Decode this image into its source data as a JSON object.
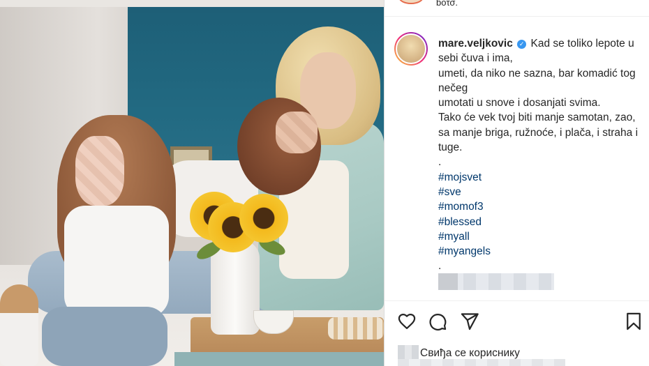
{
  "post": {
    "top_snippet": "boτσ.",
    "username": "mare.veljkovic",
    "verified_glyph": "✓",
    "caption_first": "Kad se toliko lepote u sebi čuva i ima,",
    "caption_lines": [
      "umeti, da niko ne sazna, bar komadić tog nečeg",
      "umotati u snove i dosanjati svima.",
      "Tako će vek tvoj biti manje samotan, zao, sa manje briga, ružnoće, i plača, i straha i tuge.",
      "."
    ],
    "hashtags": [
      "#mojsvet",
      "#sve",
      "#momof3",
      "#blessed",
      "#myall",
      "#myangels"
    ],
    "trailing_dot": ".",
    "likes_text": "Свиђа се кориснику"
  },
  "icons": {
    "like": "heart-icon",
    "comment": "comment-icon",
    "share": "share-icon",
    "save": "bookmark-icon"
  },
  "colors": {
    "hashtag": "#00376b",
    "verified": "#3897f0",
    "text": "#262626",
    "wall_teal": "#226a82"
  }
}
